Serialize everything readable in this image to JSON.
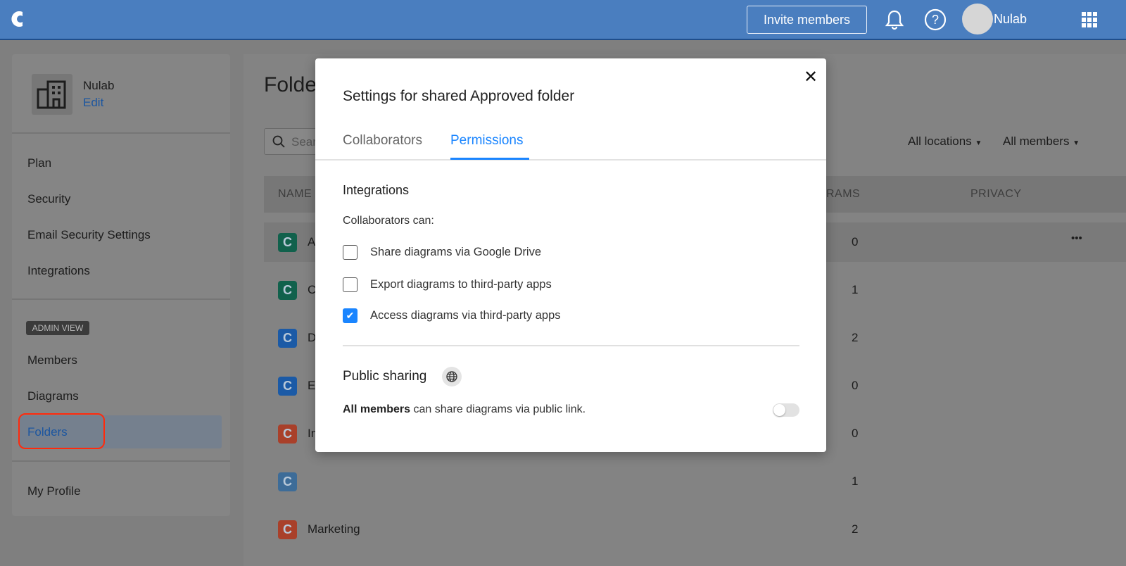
{
  "header": {
    "invite_label": "Invite members",
    "user_name": "Nulab"
  },
  "sidebar": {
    "org_name": "Nulab",
    "edit_label": "Edit",
    "items": [
      {
        "label": "Plan"
      },
      {
        "label": "Security"
      },
      {
        "label": "Email Security Settings"
      },
      {
        "label": "Integrations"
      }
    ],
    "admin_badge": "ADMIN VIEW",
    "admin_items": [
      {
        "label": "Members"
      },
      {
        "label": "Diagrams"
      },
      {
        "label": "Folders"
      }
    ],
    "profile_label": "My Profile"
  },
  "main": {
    "title": "Folde",
    "search_placeholder": "Sear",
    "filters": [
      "All locations",
      "All members"
    ],
    "columns": [
      "NAME",
      "RAMS",
      "PRIVACY"
    ],
    "rows": [
      {
        "name": "A",
        "count": "0",
        "color": "#11614c"
      },
      {
        "name": "C",
        "count": "1",
        "color": "#11614c"
      },
      {
        "name": "D",
        "count": "2",
        "color": "#1b5aa6"
      },
      {
        "name": "E",
        "count": "0",
        "color": "#1b5aa6"
      },
      {
        "name": "In",
        "count": "0",
        "color": "#a9402a"
      },
      {
        "name": "",
        "count": "1",
        "color": "#3d6c98"
      },
      {
        "name": "Marketing",
        "count": "2",
        "color": "#a9402a"
      }
    ],
    "more_label": "•••"
  },
  "modal": {
    "title": "Settings for shared Approved folder",
    "close": "✕",
    "tabs": [
      "Collaborators",
      "Permissions"
    ],
    "active_tab": "Permissions",
    "integrations_heading": "Integrations",
    "collab_can": "Collaborators can:",
    "options": [
      {
        "label": "Share diagrams via Google Drive",
        "checked": false
      },
      {
        "label": "Export diagrams to third-party apps",
        "checked": false
      },
      {
        "label": "Access diagrams via third-party apps",
        "checked": true
      }
    ],
    "public_heading": "Public sharing",
    "public_bold": "All members",
    "public_text": " can share diagrams via public link.",
    "public_enabled": false
  }
}
